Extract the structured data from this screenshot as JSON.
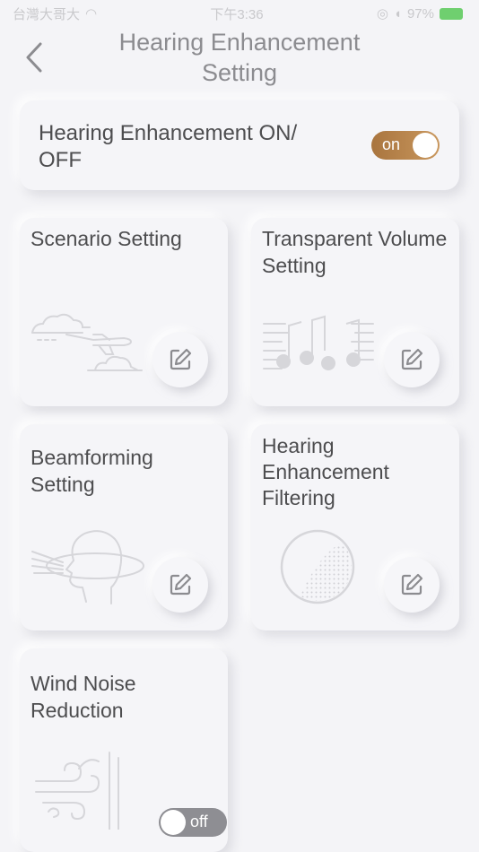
{
  "status_bar": {
    "carrier": "台灣大哥大",
    "time": "下午3:36",
    "battery": "97%"
  },
  "header": {
    "title": "Hearing Enhancement Setting"
  },
  "master": {
    "label": "Hearing Enhancement ON/ OFF",
    "toggle_text": "on",
    "state": "on",
    "accent_color": "#b8834b"
  },
  "features": [
    {
      "title": "Scenario Setting",
      "icon": "plane-clouds-icon"
    },
    {
      "title": "Transparent Volume Setting",
      "icon": "music-notes-icon"
    },
    {
      "title": "Beamforming Setting",
      "icon": "head-beam-icon"
    },
    {
      "title": "Hearing Enhancement Filtering",
      "icon": "filter-disc-icon"
    },
    {
      "title": "Wind Noise Reduction",
      "icon": "wind-icon",
      "toggle_text": "off",
      "state": "off"
    }
  ],
  "colors": {
    "background": "#f4f4f7",
    "toggle_off": "#8e8e93"
  }
}
